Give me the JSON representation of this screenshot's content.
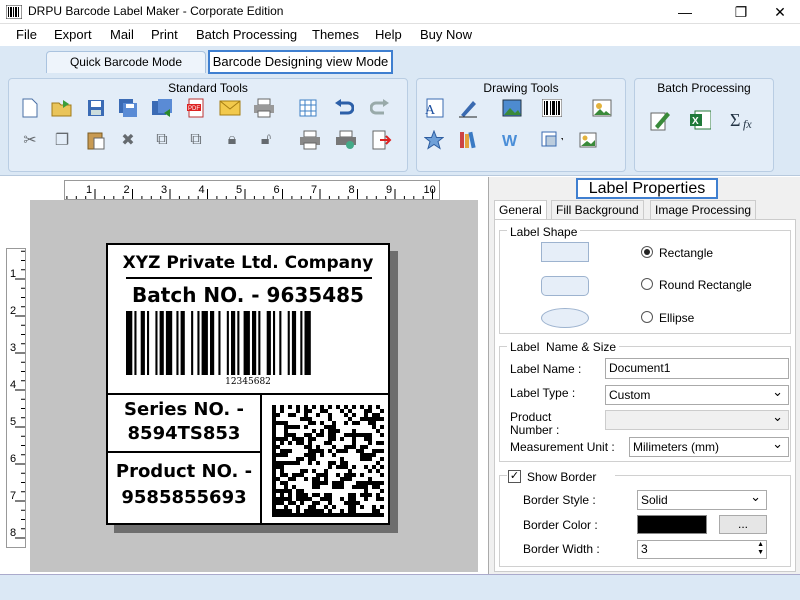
{
  "window": {
    "title": "DRPU Barcode Label Maker - Corporate Edition"
  },
  "menu": [
    "File",
    "Export",
    "Mail",
    "Print",
    "Batch Processing",
    "Themes",
    "Help",
    "Buy Now"
  ],
  "mode_tabs": {
    "quick": "Quick Barcode Mode",
    "design": "Barcode Designing view Mode"
  },
  "groups": {
    "standard": "Standard Tools",
    "drawing": "Drawing Tools",
    "batch": "Batch Processing"
  },
  "ruler": {
    "h_ticks": [
      "1",
      "2",
      "3",
      "4",
      "5",
      "6",
      "7",
      "8",
      "9",
      "10"
    ],
    "v_ticks": [
      "1",
      "2",
      "3",
      "4",
      "5",
      "6",
      "7",
      "8"
    ]
  },
  "label": {
    "company": "XYZ Private Ltd. Company",
    "batch": "Batch NO. - 9635485",
    "barcode_text": "12345682",
    "series_line1": "Series NO. -",
    "series_line2": "8594TS853",
    "product_line1": "Product NO. -",
    "product_line2": "9585855693"
  },
  "panel": {
    "title": "Label Properties",
    "tabs": [
      "General",
      "Fill Background",
      "Image Processing"
    ],
    "shape_section": "Label Shape",
    "shapes": [
      "Rectangle",
      "Round Rectangle",
      "Ellipse"
    ],
    "selected_shape": "Rectangle",
    "name_section": "Label  Name & Size",
    "label_name_lbl": "Label Name :",
    "label_name_val": "Document1",
    "label_type_lbl": "Label Type :",
    "label_type_val": "Custom",
    "product_number_lbl1": "Product",
    "product_number_lbl2": "Number :",
    "unit_lbl": "Measurement Unit :",
    "unit_val": "Milimeters (mm)",
    "show_border": "Show Border",
    "border_style_lbl": "Border Style :",
    "border_style_val": "Solid",
    "border_color_lbl": "Border Color :",
    "border_color_val": "#000000",
    "border_color_btn": "...",
    "border_width_lbl": "Border Width :",
    "border_width_val": "3"
  }
}
